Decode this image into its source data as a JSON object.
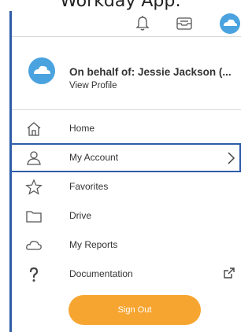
{
  "caption": "Workday App:",
  "topbar": {
    "icons": [
      "bell-icon",
      "inbox-icon",
      "avatar-icon"
    ]
  },
  "profile": {
    "name": "On behalf of: Jessie Jackson (...",
    "link": "View Profile"
  },
  "menu": {
    "items": [
      {
        "label": "Home",
        "icon": "home-icon"
      },
      {
        "label": "My Account",
        "icon": "person-icon"
      },
      {
        "label": "Favorites",
        "icon": "star-icon"
      },
      {
        "label": "Drive",
        "icon": "folder-icon"
      },
      {
        "label": "My Reports",
        "icon": "cloud-icon"
      },
      {
        "label": "Documentation",
        "icon": "question-icon"
      }
    ]
  },
  "signout": {
    "label": "Sign Out"
  },
  "colors": {
    "accent_blue": "#2f5da8",
    "sky_blue": "#4aa3df",
    "signout_orange": "#f7a531"
  }
}
